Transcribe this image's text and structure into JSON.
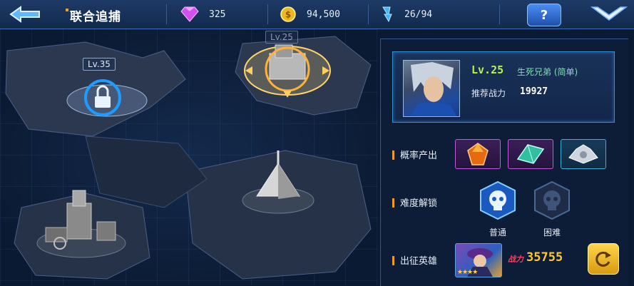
{
  "header": {
    "title": "联合追捕",
    "gems": "325",
    "coins": "94,500",
    "energy": "26/94",
    "help_label": "?"
  },
  "map": {
    "nodes": [
      {
        "id": "locked",
        "level_label": "Lv.35",
        "state": "locked"
      },
      {
        "id": "selected",
        "level_label": "Lv.25",
        "state": "selected"
      },
      {
        "id": "pyramid",
        "level_label": "",
        "state": "available"
      },
      {
        "id": "ruins",
        "level_label": "",
        "state": "available"
      }
    ]
  },
  "panel": {
    "boss": {
      "level": "Lv.25",
      "name": "生死兄弟 (简单)",
      "power_label": "推荐战力",
      "power_value": "19927"
    },
    "drops_label": "概率产出",
    "drops": [
      "orange-crystal-icon",
      "green-crystal-icon",
      "silver-gear-icon"
    ],
    "difficulty_label": "难度解锁",
    "difficulties": [
      {
        "label": "普通",
        "unlocked": true
      },
      {
        "label": "困难",
        "unlocked": false
      }
    ],
    "hero_label": "出征英雄",
    "hero_power_tag": "战力",
    "hero_power": "35755"
  },
  "colors": {
    "accent_blue": "#2f8fd0",
    "level_green": "#b9f04a",
    "power_gold": "#ffc830",
    "purple_frame": "#c05ad8"
  }
}
